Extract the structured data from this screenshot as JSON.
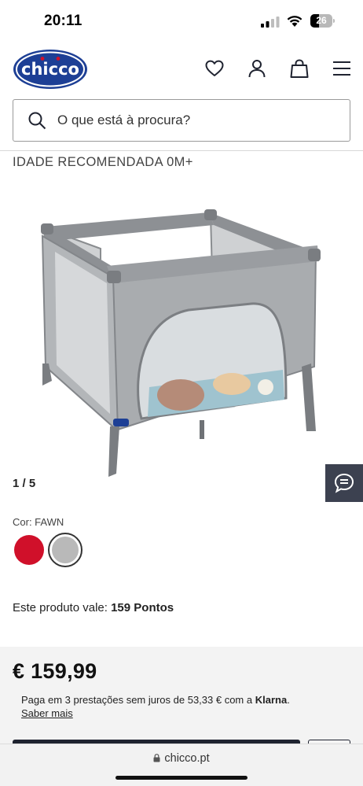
{
  "status_bar": {
    "time": "20:11",
    "battery": "26"
  },
  "header": {
    "logo_text": "chicco",
    "icons": [
      "heart-icon",
      "user-icon",
      "bag-icon",
      "menu-icon"
    ]
  },
  "search": {
    "placeholder": "O que está à procura?"
  },
  "product": {
    "age_label": "IDADE RECOMENDADA 0M+",
    "gallery_counter": "1 / 5",
    "color_label": "Cor: FAWN",
    "colors": [
      {
        "name": "red",
        "hex": "#d0102a",
        "selected": false
      },
      {
        "name": "grey",
        "hex": "#b9b9b9",
        "selected": true
      }
    ],
    "points_prefix": "Este produto vale:",
    "points_value": "159 Pontos",
    "price": "€ 159,99",
    "klarna_text": "Paga em 3 prestações sem juros de 53,33 € com a",
    "klarna_brand": "Klarna",
    "klarna_suffix": ".",
    "saber_mais": "Saber mais"
  },
  "browser": {
    "url": "chicco.pt"
  },
  "colors": {
    "brand_blue": "#1d3f95",
    "brand_red": "#d0102a",
    "chat_bg": "#3c4150"
  }
}
